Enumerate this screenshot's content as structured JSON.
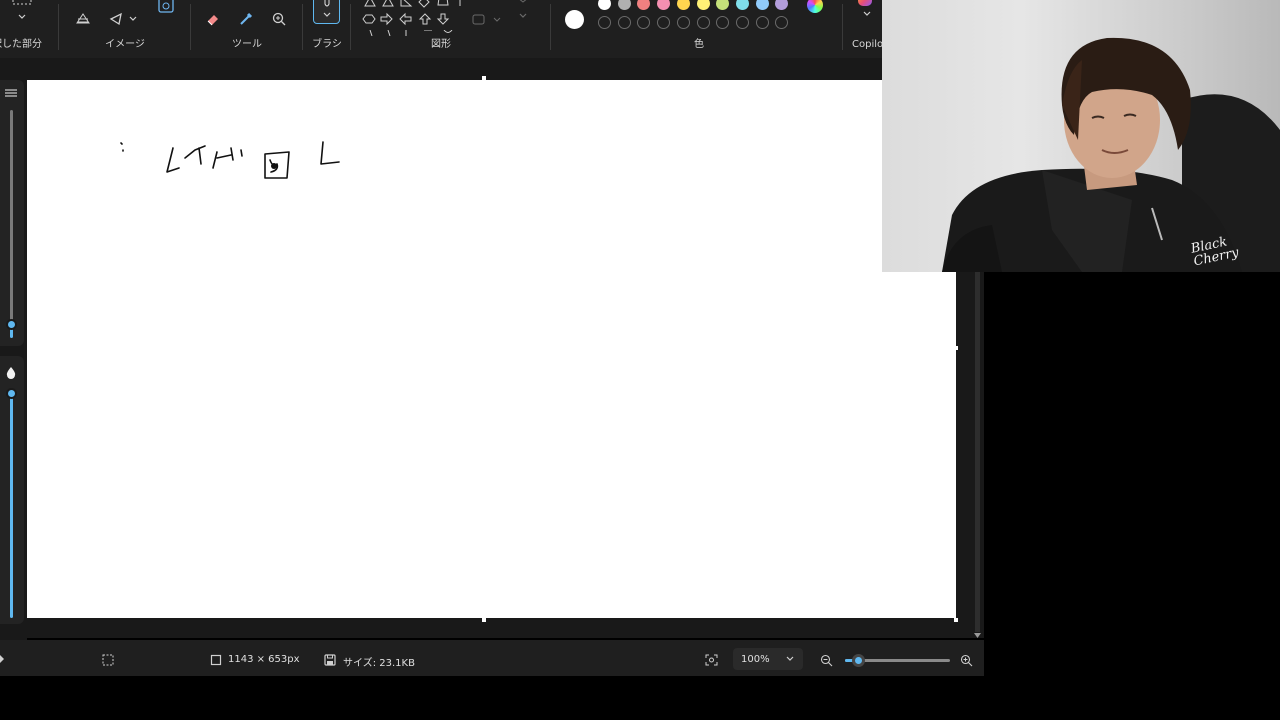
{
  "ribbon": {
    "groups": {
      "selection": "選択した部分",
      "image": "イメージ",
      "tools": "ツール",
      "brush": "ブラシ",
      "shapes": "図形",
      "colors": "色",
      "copilot": "Copilot"
    },
    "icons": {
      "selection": "chevron-down-icon",
      "image_crop": "crop-icon",
      "image_rotate": "rotate-icon",
      "image_ai": "image-ai-icon",
      "eraser": "eraser-icon",
      "color_picker": "color-picker-icon",
      "magnifier": "zoom-icon",
      "brush": "brush-icon",
      "shape_outline": "shape-outline-icon"
    },
    "palette": {
      "row1": [
        "#ffffff",
        "#b0b0b0",
        "#f08080",
        "#f48fb1",
        "#ffd54f",
        "#fff176",
        "#c5e17a",
        "#80deea",
        "#90caf9",
        "#b39ddb"
      ],
      "row2_empty_count": 10,
      "current_color": "#ffffff"
    }
  },
  "canvas": {
    "background": "#ffffff"
  },
  "statusbar": {
    "canvas_size": "1143 × 653px",
    "file_size": "サイズ: 23.1KB",
    "zoom": "100%"
  },
  "webcam": {
    "shirt_text_line1": "Black",
    "shirt_text_line2": "Cherry"
  }
}
